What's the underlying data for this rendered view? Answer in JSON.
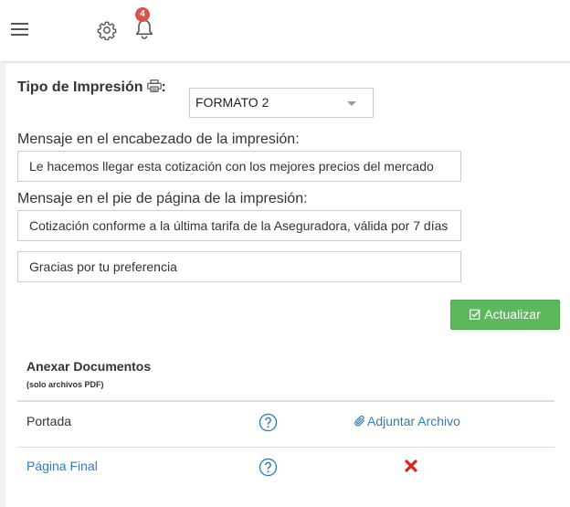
{
  "header": {
    "notifications_count": "4"
  },
  "print_settings": {
    "type_label": "Tipo de Impresión",
    "type_colon": ":",
    "format_value": "FORMATO 2",
    "header_message_label": "Mensaje en el encabezado de la impresión:",
    "header_message_value": "Le hacemos llegar esta cotización con los mejores precios del mercado",
    "footer_message_label": "Mensaje en el pie de página de la impresión:",
    "footer_message_value_1": "Cotización conforme a la última tarifa de la Aseguradora, válida por 7 días",
    "footer_message_value_2": "Gracias por tu preferencia",
    "update_button": "Actualizar"
  },
  "annex": {
    "title": "Anexar Documentos",
    "subtitle": "(solo archivos PDF)",
    "rows": [
      {
        "label": "Portada",
        "action": "Adjuntar Archivo"
      },
      {
        "label": "Página Final"
      }
    ]
  },
  "colors": {
    "accent_green": "#5cb85c",
    "link_blue": "#337ab7",
    "badge_red": "#d9534f",
    "remove_red": "#e0201b"
  },
  "icons": [
    "menu-icon",
    "gear-icon",
    "bell-icon",
    "printer-icon",
    "checkbox-icon",
    "help-icon",
    "paperclip-icon",
    "remove-icon"
  ]
}
